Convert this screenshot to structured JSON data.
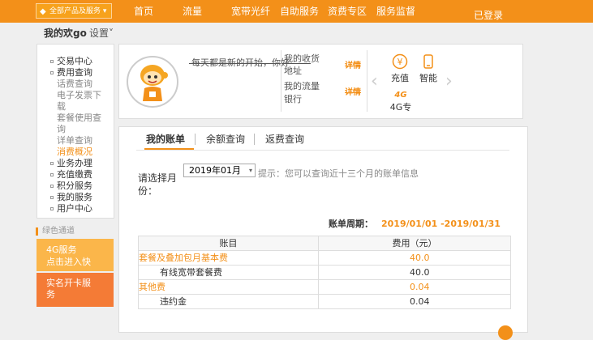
{
  "nav": {
    "products_button": "全部产品及服务",
    "items": [
      "首页",
      "流量",
      "宽带光纤",
      "自助服务",
      "资费专区",
      "服务监督"
    ],
    "login": "已登录"
  },
  "header": {
    "greeting": "我的欢go",
    "settings": "设置"
  },
  "sidebar": {
    "items": [
      {
        "label": "交易中心",
        "kind": "top"
      },
      {
        "label": "费用查询",
        "kind": "top"
      },
      {
        "label": "话费查询",
        "kind": "sub"
      },
      {
        "label": "电子发票下",
        "kind": "sub"
      },
      {
        "label": "载",
        "kind": "sub"
      },
      {
        "label": "套餐使用查",
        "kind": "sub"
      },
      {
        "label": "询",
        "kind": "sub"
      },
      {
        "label": "详单查询",
        "kind": "sub"
      },
      {
        "label": "消费概况",
        "kind": "active"
      },
      {
        "label": "业务办理",
        "kind": "top"
      },
      {
        "label": "充值缴费",
        "kind": "top"
      },
      {
        "label": "积分服务",
        "kind": "top"
      },
      {
        "label": "我的服务",
        "kind": "top"
      },
      {
        "label": "用户中心",
        "kind": "top"
      }
    ],
    "green_title": "绿色通道",
    "promo_4g": {
      "line1": "4G服务",
      "line2": "点击进入快"
    },
    "promo_realname": {
      "line1": "实名开卡服",
      "line2": "务"
    }
  },
  "profile": {
    "motto": "每天都是新的开始，你好",
    "info_lines": [
      "我的收货",
      "地址",
      "我的流量",
      "银行"
    ],
    "detail_links": [
      "详情",
      "详情"
    ],
    "services": [
      {
        "icon": "yen-icon",
        "label": "充值"
      },
      {
        "icon": "phone-icon",
        "label": "智能"
      },
      {
        "icon": "4g-icon",
        "label": "4G专"
      }
    ]
  },
  "tabs": [
    "我的账单",
    "余额查询",
    "返费查询"
  ],
  "query": {
    "label": "请选择月份：",
    "selected_month": "2019年01月",
    "hint": "提示：您可以查询近十三个月的账单信息"
  },
  "bill": {
    "period_label": "账单周期：",
    "period_value": "2019/01/01 -2019/01/31",
    "headers": [
      "账目",
      "费用（元）"
    ],
    "rows": [
      {
        "name": "套餐及叠加包月基本费",
        "amount": "40.0",
        "highlight": true
      },
      {
        "name": "有线宽带套餐费",
        "amount": "40.0",
        "highlight": false
      },
      {
        "name": "其他费",
        "amount": "0.04",
        "highlight": true
      },
      {
        "name": "违约金",
        "amount": "0.04",
        "highlight": false
      }
    ]
  },
  "colors": {
    "brand_orange": "#f39019",
    "promo_yellow": "#fbb64a",
    "promo_orange": "#f47b36"
  }
}
